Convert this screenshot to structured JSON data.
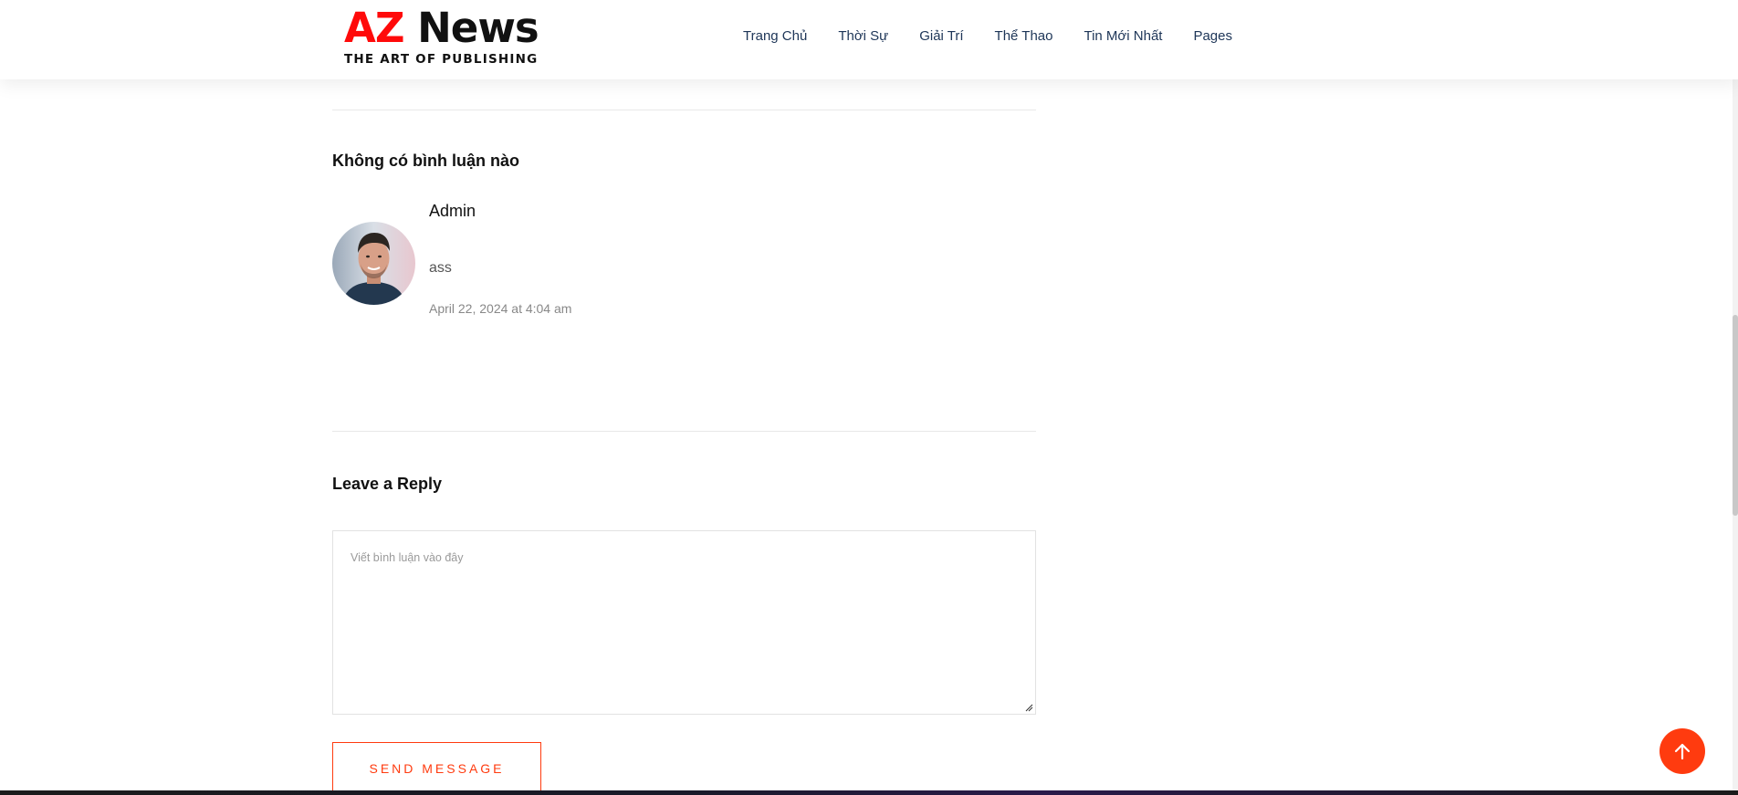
{
  "header": {
    "logo": {
      "main_a": "AZ",
      "main_b": " News",
      "tagline": "THE ART OF PUBLISHING"
    },
    "nav": [
      "Trang Chủ",
      "Thời Sự",
      "Giải Trí",
      "Thể Thao",
      "Tin Mới Nhất",
      "Pages"
    ]
  },
  "comments": {
    "title": "Không có bình luận nào",
    "items": [
      {
        "author": "Admin",
        "text": "ass",
        "date": "April 22, 2024 at 4:04 am"
      }
    ]
  },
  "reply": {
    "title": "Leave a Reply",
    "textarea_placeholder": "Viết bình luận vào đây",
    "send_label": "SEND MESSAGE"
  },
  "colors": {
    "accent": "#ff3b0f",
    "logo_red": "#ff0a0a",
    "nav_text": "#1d3557"
  },
  "icons": {
    "scroll_top": "arrow-up-icon"
  }
}
